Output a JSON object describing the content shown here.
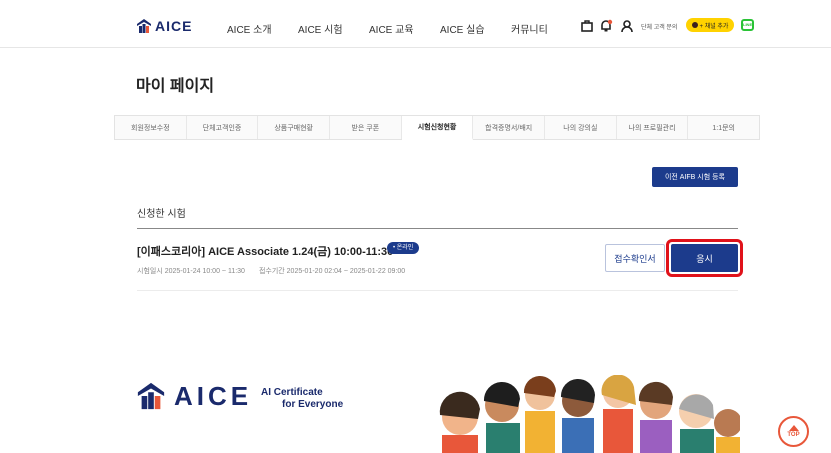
{
  "header": {
    "logo_text": "AICE",
    "nav": [
      {
        "label": "AICE 소개"
      },
      {
        "label": "AICE 시험"
      },
      {
        "label": "AICE 교육"
      },
      {
        "label": "AICE 실습"
      },
      {
        "label": "커뮤니티"
      }
    ],
    "group_inquiry": "단체 고객 문의",
    "kakao_label": "+ 채널 추가",
    "line_label": "LINE"
  },
  "page_title": "마이 페이지",
  "tabs": [
    {
      "label": "회원정보수정"
    },
    {
      "label": "단체고객인증"
    },
    {
      "label": "상품구매현황"
    },
    {
      "label": "받은 쿠폰"
    },
    {
      "label": "시험신청현황",
      "active": true
    },
    {
      "label": "합격증명서/배지"
    },
    {
      "label": "나의 강의실"
    },
    {
      "label": "나의 프로필관리"
    },
    {
      "label": "1:1문의"
    }
  ],
  "prev_register_label": "이전 AIFB 시험 등록",
  "section_title": "신청한 시험",
  "exam": {
    "title": "[이패스코리아] AICE Associate 1.24(금) 10:00-11:30",
    "badge": "• 온라인",
    "exam_datetime": "시험일시 2025-01-24 10:00 ~ 11:30",
    "apply_period": "접수기간 2025-01-20 02:04 ~ 2025-01-22 09:00",
    "receipt_label": "접수확인서",
    "apply_label": "응시"
  },
  "footer": {
    "logo_text": "AICE",
    "tagline_1": "AI Certificate",
    "tagline_2": "for Everyone"
  },
  "top_button": "TOP",
  "colors": {
    "brand_navy": "#1c3b8c",
    "highlight_red": "#e0121a",
    "kakao_yellow": "#ffd200",
    "top_orange": "#e8573a"
  }
}
